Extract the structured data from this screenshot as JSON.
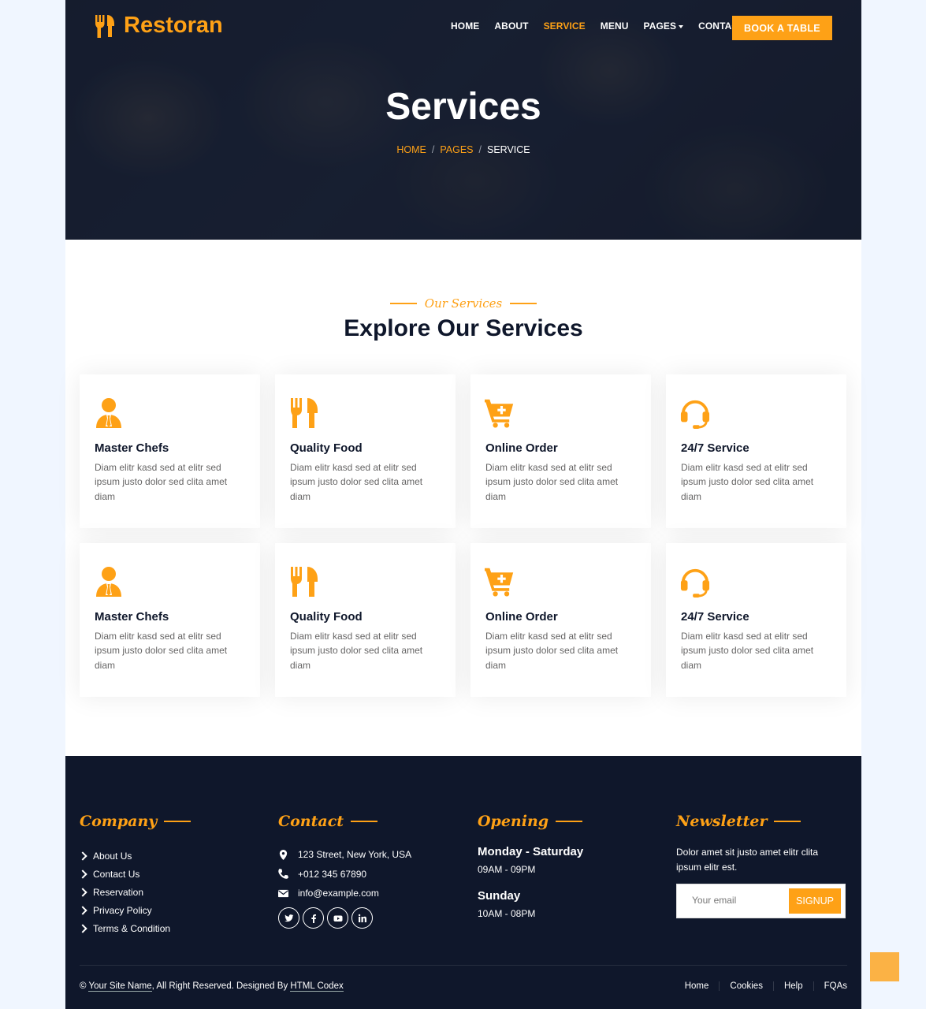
{
  "brand": {
    "name": "Restoran",
    "accent": "#FEA116",
    "dark": "#0F172B"
  },
  "nav": {
    "items": [
      "HOME",
      "ABOUT",
      "SERVICE",
      "MENU",
      "PAGES",
      "CONTACT"
    ],
    "active": "SERVICE",
    "book_label": "BOOK A TABLE"
  },
  "hero": {
    "title": "Services",
    "breadcrumb": [
      "HOME",
      "PAGES",
      "SERVICE"
    ]
  },
  "services": {
    "subtitle": "Our Services",
    "title": "Explore Our Services",
    "cards": [
      {
        "icon": "chef-icon",
        "title": "Master Chefs",
        "text": "Diam elitr kasd sed at elitr sed ipsum justo dolor sed clita amet diam"
      },
      {
        "icon": "utensils-icon",
        "title": "Quality Food",
        "text": "Diam elitr kasd sed at elitr sed ipsum justo dolor sed clita amet diam"
      },
      {
        "icon": "cart-plus-icon",
        "title": "Online Order",
        "text": "Diam elitr kasd sed at elitr sed ipsum justo dolor sed clita amet diam"
      },
      {
        "icon": "headset-icon",
        "title": "24/7 Service",
        "text": "Diam elitr kasd sed at elitr sed ipsum justo dolor sed clita amet diam"
      },
      {
        "icon": "chef-icon",
        "title": "Master Chefs",
        "text": "Diam elitr kasd sed at elitr sed ipsum justo dolor sed clita amet diam"
      },
      {
        "icon": "utensils-icon",
        "title": "Quality Food",
        "text": "Diam elitr kasd sed at elitr sed ipsum justo dolor sed clita amet diam"
      },
      {
        "icon": "cart-plus-icon",
        "title": "Online Order",
        "text": "Diam elitr kasd sed at elitr sed ipsum justo dolor sed clita amet diam"
      },
      {
        "icon": "headset-icon",
        "title": "24/7 Service",
        "text": "Diam elitr kasd sed at elitr sed ipsum justo dolor sed clita amet diam"
      }
    ]
  },
  "footer": {
    "company": {
      "title": "Company",
      "links": [
        "About Us",
        "Contact Us",
        "Reservation",
        "Privacy Policy",
        "Terms & Condition"
      ]
    },
    "contact": {
      "title": "Contact",
      "address": "123 Street, New York, USA",
      "phone": "+012 345 67890",
      "email": "info@example.com",
      "socials": [
        "twitter-icon",
        "facebook-icon",
        "youtube-icon",
        "linkedin-icon"
      ]
    },
    "opening": {
      "title": "Opening",
      "day1": "Monday - Saturday",
      "time1": "09AM - 09PM",
      "day2": "Sunday",
      "time2": "10AM - 08PM"
    },
    "newsletter": {
      "title": "Newsletter",
      "text": "Dolor amet sit justo amet elitr clita ipsum elitr est.",
      "placeholder": "Your email",
      "button": "SIGNUP"
    },
    "copyright": {
      "prefix": "©",
      "site_name": "Your Site Name",
      "middle": ", All Right Reserved. Designed By",
      "designer": "HTML Codex"
    },
    "menu": [
      "Home",
      "Cookies",
      "Help",
      "FQAs"
    ]
  }
}
